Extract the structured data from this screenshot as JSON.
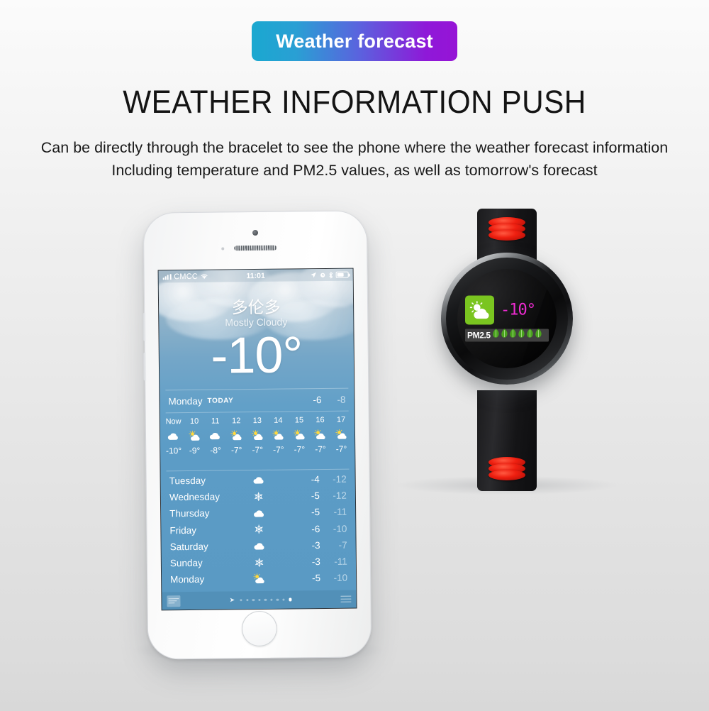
{
  "badge": {
    "label": "Weather forecast",
    "gradient_from": "#1aa8d0",
    "gradient_to": "#9614d6"
  },
  "headline": "WEATHER INFORMATION PUSH",
  "subtitle": {
    "line1": "Can be directly through the bracelet to see the phone where the weather forecast information",
    "line2": "Including temperature and PM2.5 values, as well as tomorrow's forecast"
  },
  "phone": {
    "statusbar": {
      "carrier": "CMCC",
      "time": "11:01",
      "icons": [
        "signal-bars-icon",
        "wifi-icon",
        "location-arrow-icon",
        "alarm-clock-icon",
        "bluetooth-icon",
        "battery-icon"
      ]
    },
    "weather": {
      "city": "多伦多",
      "condition": "Mostly Cloudy",
      "current_temp": "-10°",
      "today": {
        "day": "Monday",
        "tag": "TODAY",
        "high": "-6",
        "low": "-8"
      },
      "hourly": [
        {
          "label": "Now",
          "icon": "cloud-icon",
          "temp": "-10°"
        },
        {
          "label": "10",
          "icon": "sun-cloud-icon",
          "temp": "-9°"
        },
        {
          "label": "11",
          "icon": "cloud-icon",
          "temp": "-8°"
        },
        {
          "label": "12",
          "icon": "sun-cloud-icon",
          "temp": "-7°"
        },
        {
          "label": "13",
          "icon": "sun-cloud-icon",
          "temp": "-7°"
        },
        {
          "label": "14",
          "icon": "sun-cloud-icon",
          "temp": "-7°"
        },
        {
          "label": "15",
          "icon": "sun-cloud-icon",
          "temp": "-7°"
        },
        {
          "label": "16",
          "icon": "sun-cloud-icon",
          "temp": "-7°"
        },
        {
          "label": "17",
          "icon": "sun-cloud-icon",
          "temp": "-7°"
        }
      ],
      "daily": [
        {
          "day": "Tuesday",
          "icon": "cloud-icon",
          "high": "-4",
          "low": "-12"
        },
        {
          "day": "Wednesday",
          "icon": "snowflake-icon",
          "high": "-5",
          "low": "-12"
        },
        {
          "day": "Thursday",
          "icon": "cloud-icon",
          "high": "-5",
          "low": "-11"
        },
        {
          "day": "Friday",
          "icon": "snowflake-icon",
          "high": "-6",
          "low": "-10"
        },
        {
          "day": "Saturday",
          "icon": "cloud-icon",
          "high": "-3",
          "low": "-7"
        },
        {
          "day": "Sunday",
          "icon": "snowflake-icon",
          "high": "-3",
          "low": "-11"
        },
        {
          "day": "Monday",
          "icon": "sun-cloud-icon",
          "high": "-5",
          "low": "-10"
        }
      ]
    },
    "toolbar": {
      "logo": "weather-channel-logo",
      "page_dots_total": 9,
      "page_dots_active_index": 9,
      "list_icon": "list-icon"
    }
  },
  "watch": {
    "weather_icon": "sun-cloud-icon",
    "weather_icon_bg": "#7ac520",
    "temp": "-10°",
    "temp_color": "#ef2bd2",
    "pm25_label": "PM2.5",
    "pm25_leaves": 6,
    "leaf_color": "#4aa31e",
    "strap_accent_color": "#ee1f10"
  }
}
